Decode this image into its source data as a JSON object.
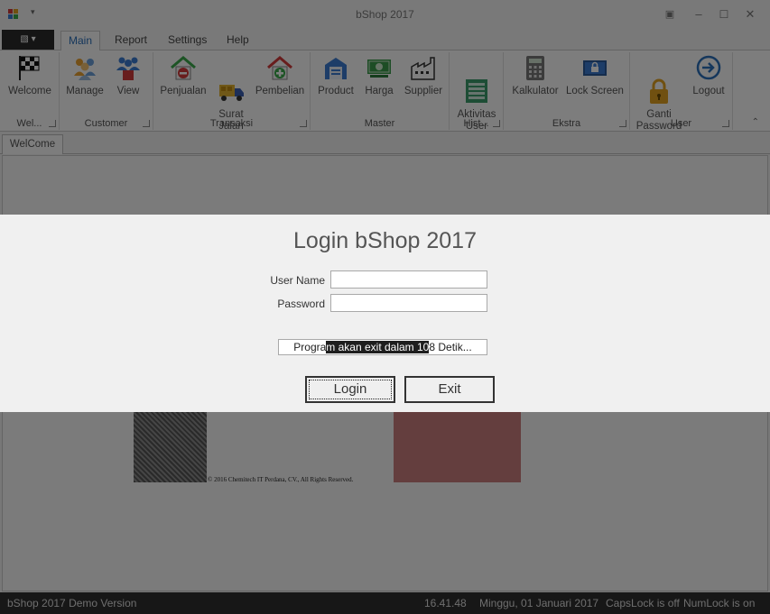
{
  "window": {
    "title": "bShop 2017",
    "quick_access": "▾"
  },
  "ribbon": {
    "tabs": [
      "Main",
      "Report",
      "Settings",
      "Help"
    ],
    "active_tab": "Main",
    "groups": [
      {
        "caption": "Wel...",
        "buttons": [
          {
            "label": "Welcome",
            "icon": "checkered-flag-icon"
          }
        ]
      },
      {
        "caption": "Customer",
        "buttons": [
          {
            "label": "Manage",
            "icon": "people-group-icon"
          },
          {
            "label": "View",
            "icon": "people-view-icon"
          }
        ]
      },
      {
        "caption": "Transaksi",
        "buttons": [
          {
            "label": "Penjualan",
            "icon": "house-minus-icon"
          },
          {
            "label": "Surat\nJalan",
            "icon": "delivery-truck-icon"
          },
          {
            "label": "Pembelian",
            "icon": "house-plus-icon"
          }
        ]
      },
      {
        "caption": "Master",
        "buttons": [
          {
            "label": "Product",
            "icon": "warehouse-icon"
          },
          {
            "label": "Harga",
            "icon": "money-icon"
          },
          {
            "label": "Supplier",
            "icon": "factory-icon"
          }
        ]
      },
      {
        "caption": "Hist...",
        "buttons": [
          {
            "label": "Aktivitas\nUser",
            "icon": "list-icon"
          }
        ]
      },
      {
        "caption": "Ekstra",
        "buttons": [
          {
            "label": "Kalkulator",
            "icon": "calculator-icon"
          },
          {
            "label": "Lock Screen",
            "icon": "lock-screen-icon"
          }
        ]
      },
      {
        "caption": "User",
        "buttons": [
          {
            "label": "Ganti\nPassword",
            "icon": "padlock-icon"
          },
          {
            "label": "Logout",
            "icon": "logout-arrow-icon"
          }
        ]
      }
    ]
  },
  "document_tab": "WelCome",
  "welcome": {
    "copyright": "© 2016 Chemitech IT Perdana, CV., All Rights Reserved."
  },
  "login": {
    "title": "Login bShop 2017",
    "username_label": "User Name",
    "username_value": "",
    "password_label": "Password",
    "password_value": "",
    "countdown": {
      "before": "Progra",
      "highlight": "m akan exit dalam 10",
      "after": "8 Detik..."
    },
    "login_button": "Login",
    "exit_button": "Exit"
  },
  "statusbar": {
    "version": "bShop 2017 Demo Version",
    "time": "16.41.48",
    "date": "Minggu, 01 Januari 2017",
    "capslock": "CapsLock is off",
    "numlock": "NumLock is on"
  },
  "colors": {
    "accent": "#2a6eb8",
    "statusbar": "#2e2e2e"
  }
}
